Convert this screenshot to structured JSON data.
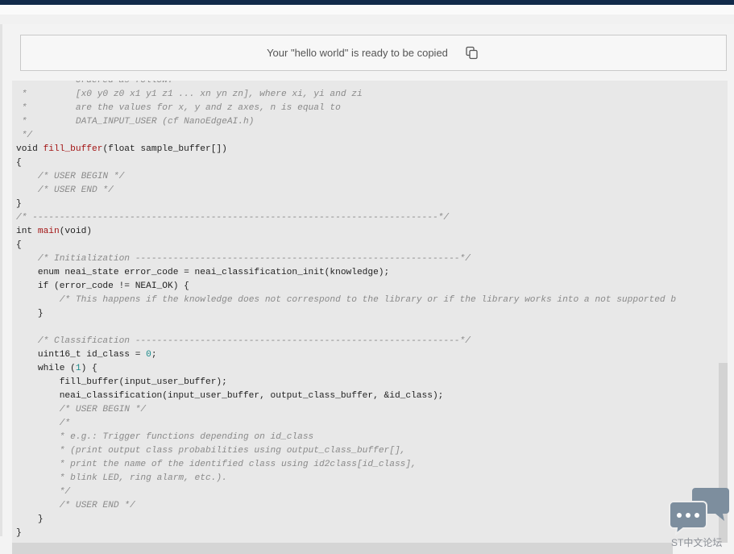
{
  "banner": {
    "message": "Your \"hello world\" is ready to be copied"
  },
  "code_lines": [
    [
      [
        "c",
        " *         ordered as follow:"
      ]
    ],
    [
      [
        "c",
        " *         [x0 y0 z0 x1 y1 z1 ... xn yn zn], where xi, yi and zi"
      ]
    ],
    [
      [
        "c",
        " *         are the values for x, y and z axes, n is equal to"
      ]
    ],
    [
      [
        "c",
        " *         DATA_INPUT_USER (cf NanoEdgeAI.h)"
      ]
    ],
    [
      [
        "c",
        " */"
      ]
    ],
    [
      [
        "t",
        "void "
      ],
      [
        "fn",
        "fill_buffer"
      ],
      [
        "t",
        "(float sample_buffer[])"
      ]
    ],
    [
      [
        "t",
        "{"
      ]
    ],
    [
      [
        "t",
        "    "
      ],
      [
        "c",
        "/* USER BEGIN */"
      ]
    ],
    [
      [
        "t",
        "    "
      ],
      [
        "c",
        "/* USER END */"
      ]
    ],
    [
      [
        "t",
        "}"
      ]
    ],
    [
      [
        "c",
        "/* ---------------------------------------------------------------------------*/"
      ]
    ],
    [
      [
        "t",
        "int "
      ],
      [
        "fn",
        "main"
      ],
      [
        "t",
        "(void)"
      ]
    ],
    [
      [
        "t",
        "{"
      ]
    ],
    [
      [
        "t",
        "    "
      ],
      [
        "c",
        "/* Initialization ------------------------------------------------------------*/"
      ]
    ],
    [
      [
        "t",
        "    enum neai_state error_code = neai_classification_init(knowledge);"
      ]
    ],
    [
      [
        "t",
        "    if (error_code != NEAI_OK) {"
      ]
    ],
    [
      [
        "t",
        "        "
      ],
      [
        "c",
        "/* This happens if the knowledge does not correspond to the library or if the library works into a not supported b"
      ]
    ],
    [
      [
        "t",
        "    }"
      ]
    ],
    [
      [
        "t",
        ""
      ]
    ],
    [
      [
        "t",
        "    "
      ],
      [
        "c",
        "/* Classification ------------------------------------------------------------*/"
      ]
    ],
    [
      [
        "t",
        "    uint16_t id_class = "
      ],
      [
        "num",
        "0"
      ],
      [
        "t",
        ";"
      ]
    ],
    [
      [
        "t",
        "    while ("
      ],
      [
        "num",
        "1"
      ],
      [
        "t",
        ") {"
      ]
    ],
    [
      [
        "t",
        "        fill_buffer(input_user_buffer);"
      ]
    ],
    [
      [
        "t",
        "        neai_classification(input_user_buffer, output_class_buffer, &id_class);"
      ]
    ],
    [
      [
        "t",
        "        "
      ],
      [
        "c",
        "/* USER BEGIN */"
      ]
    ],
    [
      [
        "t",
        "        "
      ],
      [
        "c",
        "/*"
      ]
    ],
    [
      [
        "t",
        "        "
      ],
      [
        "c",
        "* e.g.: Trigger functions depending on id_class"
      ]
    ],
    [
      [
        "t",
        "        "
      ],
      [
        "c",
        "* (print output class probabilities using output_class_buffer[],"
      ]
    ],
    [
      [
        "t",
        "        "
      ],
      [
        "c",
        "* print the name of the identified class using id2class[id_class],"
      ]
    ],
    [
      [
        "t",
        "        "
      ],
      [
        "c",
        "* blink LED, ring alarm, etc.)."
      ]
    ],
    [
      [
        "t",
        "        "
      ],
      [
        "c",
        "*/"
      ]
    ],
    [
      [
        "t",
        "        "
      ],
      [
        "c",
        "/* USER END */"
      ]
    ],
    [
      [
        "t",
        "    }"
      ]
    ],
    [
      [
        "t",
        "}"
      ]
    ]
  ],
  "chat_widget": {
    "label": "ST中文论坛",
    "icon": "chat-bubbles-icon"
  },
  "icons": {
    "copy": "copy-icon"
  },
  "colors": {
    "topbar": "#112a4a",
    "function_name": "#a31515",
    "comment": "#8a8a8a",
    "number": "#1a8a8a"
  }
}
